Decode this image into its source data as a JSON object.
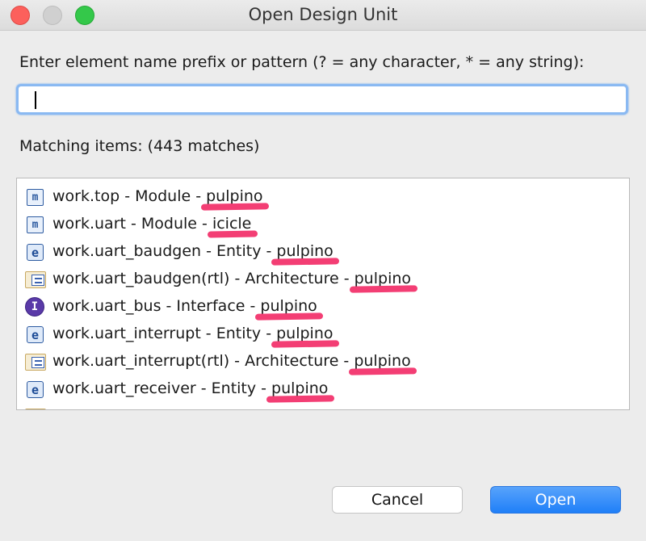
{
  "window": {
    "title": "Open Design Unit",
    "controls": [
      "close-icon",
      "minimize-icon",
      "zoom-icon"
    ],
    "control_colors": {
      "close": "#fc605c",
      "minimize": "#d0d0d0",
      "zoom": "#34c84a"
    }
  },
  "search": {
    "prompt": "Enter element name prefix or pattern (? = any character, * = any string):",
    "value": "",
    "focus_color": "#8ab9f2"
  },
  "results": {
    "label": "Matching items: (443 matches)",
    "items": [
      {
        "name": "work.top - Module - ",
        "lib": "pulpino",
        "icon": "module-icon"
      },
      {
        "name": "work.uart - Module - ",
        "lib": "icicle",
        "icon": "module-icon"
      },
      {
        "name": "work.uart_baudgen - Entity - ",
        "lib": "pulpino",
        "icon": "entity-icon"
      },
      {
        "name": "work.uart_baudgen(rtl) - Architecture - ",
        "lib": "pulpino",
        "icon": "architecture-icon"
      },
      {
        "name": "work.uart_bus - Interface - ",
        "lib": "pulpino",
        "icon": "interface-icon"
      },
      {
        "name": "work.uart_interrupt - Entity - ",
        "lib": "pulpino",
        "icon": "entity-icon"
      },
      {
        "name": "work.uart_interrupt(rtl) - Architecture - ",
        "lib": "pulpino",
        "icon": "architecture-icon"
      },
      {
        "name": "work.uart_receiver - Entity - ",
        "lib": "pulpino",
        "icon": "entity-icon"
      },
      {
        "name": "",
        "lib": "",
        "icon": "architecture-icon"
      }
    ],
    "highlight_color": "#f2346d"
  },
  "buttons": {
    "cancel": "Cancel",
    "open": "Open"
  },
  "accent": "#1f7ff8"
}
